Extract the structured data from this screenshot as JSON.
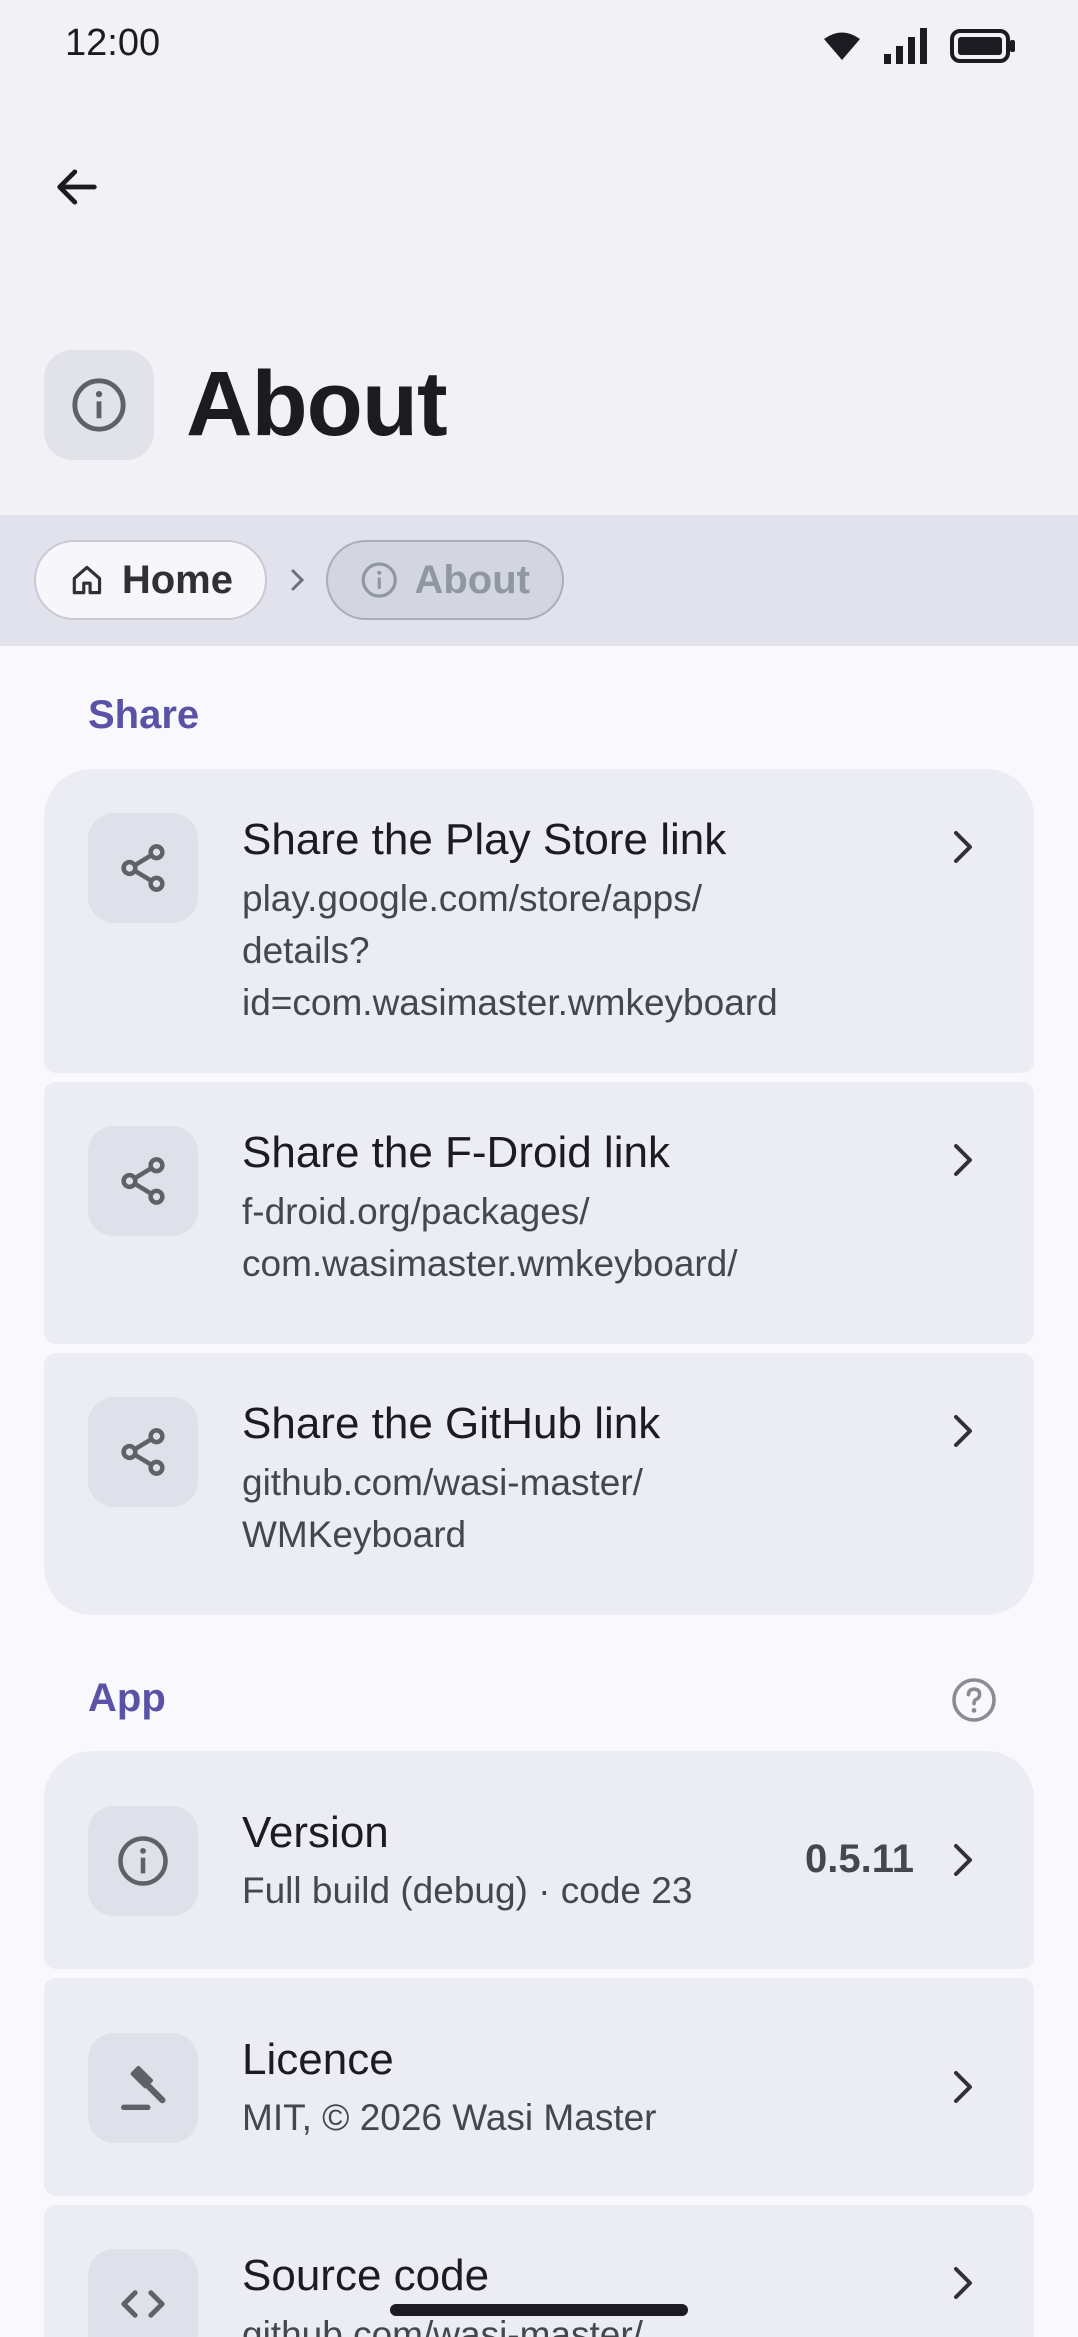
{
  "status": {
    "time": "12:00"
  },
  "header": {
    "title": "About"
  },
  "breadcrumb": {
    "home": "Home",
    "current": "About"
  },
  "sections": {
    "share": {
      "title": "Share",
      "items": [
        {
          "title": "Share the Play Store link",
          "subtitle": "play.google.com/store/apps/\ndetails?\nid=com.wasimaster.wmkeyboard"
        },
        {
          "title": "Share the F-Droid link",
          "subtitle": "f-droid.org/packages/\ncom.wasimaster.wmkeyboard/"
        },
        {
          "title": "Share the GitHub link",
          "subtitle": "github.com/wasi-master/\nWMKeyboard"
        }
      ]
    },
    "app": {
      "title": "App",
      "items": [
        {
          "title": "Version",
          "subtitle": "Full build (debug) · code 23",
          "value": "0.5.11"
        },
        {
          "title": "Licence",
          "subtitle": "MIT, © 2026 Wasi Master"
        },
        {
          "title": "Source code",
          "subtitle": "github.com/wasi-master/"
        }
      ]
    }
  },
  "colors": {
    "accent": "#5a52a6",
    "card": "#ececf5",
    "background": "#f9f9fd"
  }
}
